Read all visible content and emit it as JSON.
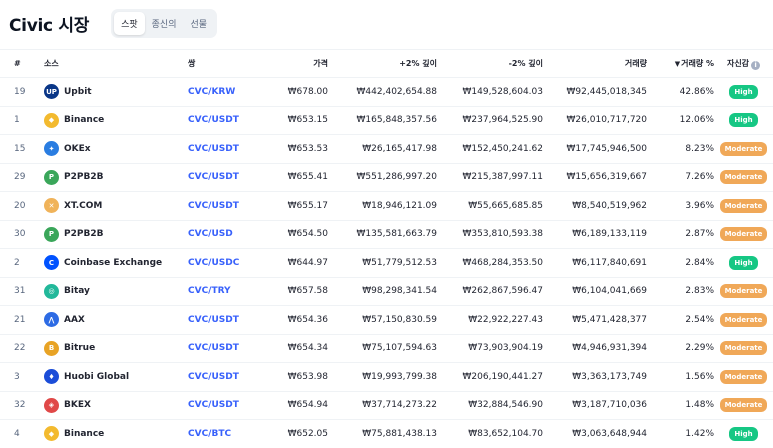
{
  "page_title": "Civic 시장",
  "tabs": [
    {
      "label": "스팟",
      "active": true
    },
    {
      "label": "종신의",
      "active": false
    },
    {
      "label": "선물",
      "active": false
    }
  ],
  "columns": {
    "rank": "#",
    "source": "소스",
    "pair": "쌍",
    "price": "가격",
    "depth_plus": "+2% 깊이",
    "depth_minus": "-2% 깊이",
    "volume": "거래량",
    "volume_pct": "거래량 %",
    "confidence": "자신감"
  },
  "icons": {
    "info": "info-icon",
    "sort": "sort-down-icon"
  },
  "colors": {
    "high": "#16c784",
    "moderate": "#f0a858",
    "pair_link": "#3861fb"
  },
  "rows": [
    {
      "rank": "19",
      "exchange": "Upbit",
      "logo": {
        "icon": "upbit-logo",
        "glyph": "UP",
        "color": "#093687"
      },
      "pair": "CVC/KRW",
      "price": "₩678.00",
      "depth_plus": "₩442,402,654.88",
      "depth_minus": "₩149,528,604.03",
      "volume": "₩92,445,018,345",
      "volume_pct": "42.86%",
      "confidence": "High",
      "conf_level": "high"
    },
    {
      "rank": "1",
      "exchange": "Binance",
      "logo": {
        "icon": "binance-logo",
        "glyph": "◆",
        "color": "#f3ba2f"
      },
      "pair": "CVC/USDT",
      "price": "₩653.15",
      "depth_plus": "₩165,848,357.56",
      "depth_minus": "₩237,964,525.90",
      "volume": "₩26,010,717,720",
      "volume_pct": "12.06%",
      "confidence": "High",
      "conf_level": "high"
    },
    {
      "rank": "15",
      "exchange": "OKEx",
      "logo": {
        "icon": "okex-logo",
        "glyph": "✦",
        "color": "#2a7de1"
      },
      "pair": "CVC/USDT",
      "price": "₩653.53",
      "depth_plus": "₩26,165,417.98",
      "depth_minus": "₩152,450,241.62",
      "volume": "₩17,745,946,500",
      "volume_pct": "8.23%",
      "confidence": "Moderate",
      "conf_level": "moderate"
    },
    {
      "rank": "29",
      "exchange": "P2PB2B",
      "logo": {
        "icon": "p2pb2b-logo",
        "glyph": "P",
        "color": "#3aa65a"
      },
      "pair": "CVC/USDT",
      "price": "₩655.41",
      "depth_plus": "₩551,286,997.20",
      "depth_minus": "₩215,387,997.11",
      "volume": "₩15,656,319,667",
      "volume_pct": "7.26%",
      "confidence": "Moderate",
      "conf_level": "moderate"
    },
    {
      "rank": "20",
      "exchange": "XT.COM",
      "logo": {
        "icon": "xtcom-logo",
        "glyph": "✕",
        "color": "#f0b35a"
      },
      "pair": "CVC/USDT",
      "price": "₩655.17",
      "depth_plus": "₩18,946,121.09",
      "depth_minus": "₩55,665,685.85",
      "volume": "₩8,540,519,962",
      "volume_pct": "3.96%",
      "confidence": "Moderate",
      "conf_level": "moderate"
    },
    {
      "rank": "30",
      "exchange": "P2PB2B",
      "logo": {
        "icon": "p2pb2b-logo",
        "glyph": "P",
        "color": "#3aa65a"
      },
      "pair": "CVC/USD",
      "price": "₩654.50",
      "depth_plus": "₩135,581,663.79",
      "depth_minus": "₩353,810,593.38",
      "volume": "₩6,189,133,119",
      "volume_pct": "2.87%",
      "confidence": "Moderate",
      "conf_level": "moderate"
    },
    {
      "rank": "2",
      "exchange": "Coinbase Exchange",
      "logo": {
        "icon": "coinbase-logo",
        "glyph": "C",
        "color": "#0052ff"
      },
      "pair": "CVC/USDC",
      "price": "₩644.97",
      "depth_plus": "₩51,779,512.53",
      "depth_minus": "₩468,284,353.50",
      "volume": "₩6,117,840,691",
      "volume_pct": "2.84%",
      "confidence": "High",
      "conf_level": "high"
    },
    {
      "rank": "31",
      "exchange": "Bitay",
      "logo": {
        "icon": "bitay-logo",
        "glyph": "◎",
        "color": "#22b89a"
      },
      "pair": "CVC/TRY",
      "price": "₩657.58",
      "depth_plus": "₩98,298,341.54",
      "depth_minus": "₩262,867,596.47",
      "volume": "₩6,104,041,669",
      "volume_pct": "2.83%",
      "confidence": "Moderate",
      "conf_level": "moderate"
    },
    {
      "rank": "21",
      "exchange": "AAX",
      "logo": {
        "icon": "aax-logo",
        "glyph": "⋀",
        "color": "#2d6be4"
      },
      "pair": "CVC/USDT",
      "price": "₩654.36",
      "depth_plus": "₩57,150,830.59",
      "depth_minus": "₩22,922,227.43",
      "volume": "₩5,471,428,377",
      "volume_pct": "2.54%",
      "confidence": "Moderate",
      "conf_level": "moderate"
    },
    {
      "rank": "22",
      "exchange": "Bitrue",
      "logo": {
        "icon": "bitrue-logo",
        "glyph": "B",
        "color": "#e8a325"
      },
      "pair": "CVC/USDT",
      "price": "₩654.34",
      "depth_plus": "₩75,107,594.63",
      "depth_minus": "₩73,903,904.19",
      "volume": "₩4,946,931,394",
      "volume_pct": "2.29%",
      "confidence": "Moderate",
      "conf_level": "moderate"
    },
    {
      "rank": "3",
      "exchange": "Huobi Global",
      "logo": {
        "icon": "huobi-logo",
        "glyph": "♦",
        "color": "#1b4dd8"
      },
      "pair": "CVC/USDT",
      "price": "₩653.98",
      "depth_plus": "₩19,993,799.38",
      "depth_minus": "₩206,190,441.27",
      "volume": "₩3,363,173,749",
      "volume_pct": "1.56%",
      "confidence": "Moderate",
      "conf_level": "moderate"
    },
    {
      "rank": "32",
      "exchange": "BKEX",
      "logo": {
        "icon": "bkex-logo",
        "glyph": "◈",
        "color": "#e04848"
      },
      "pair": "CVC/USDT",
      "price": "₩654.94",
      "depth_plus": "₩37,714,273.22",
      "depth_minus": "₩32,884,546.90",
      "volume": "₩3,187,710,036",
      "volume_pct": "1.48%",
      "confidence": "Moderate",
      "conf_level": "moderate"
    },
    {
      "rank": "4",
      "exchange": "Binance",
      "logo": {
        "icon": "binance-logo",
        "glyph": "◆",
        "color": "#f3ba2f"
      },
      "pair": "CVC/BTC",
      "price": "₩652.05",
      "depth_plus": "₩75,881,438.13",
      "depth_minus": "₩83,652,104.70",
      "volume": "₩3,063,648,944",
      "volume_pct": "1.42%",
      "confidence": "High",
      "conf_level": "high"
    }
  ]
}
